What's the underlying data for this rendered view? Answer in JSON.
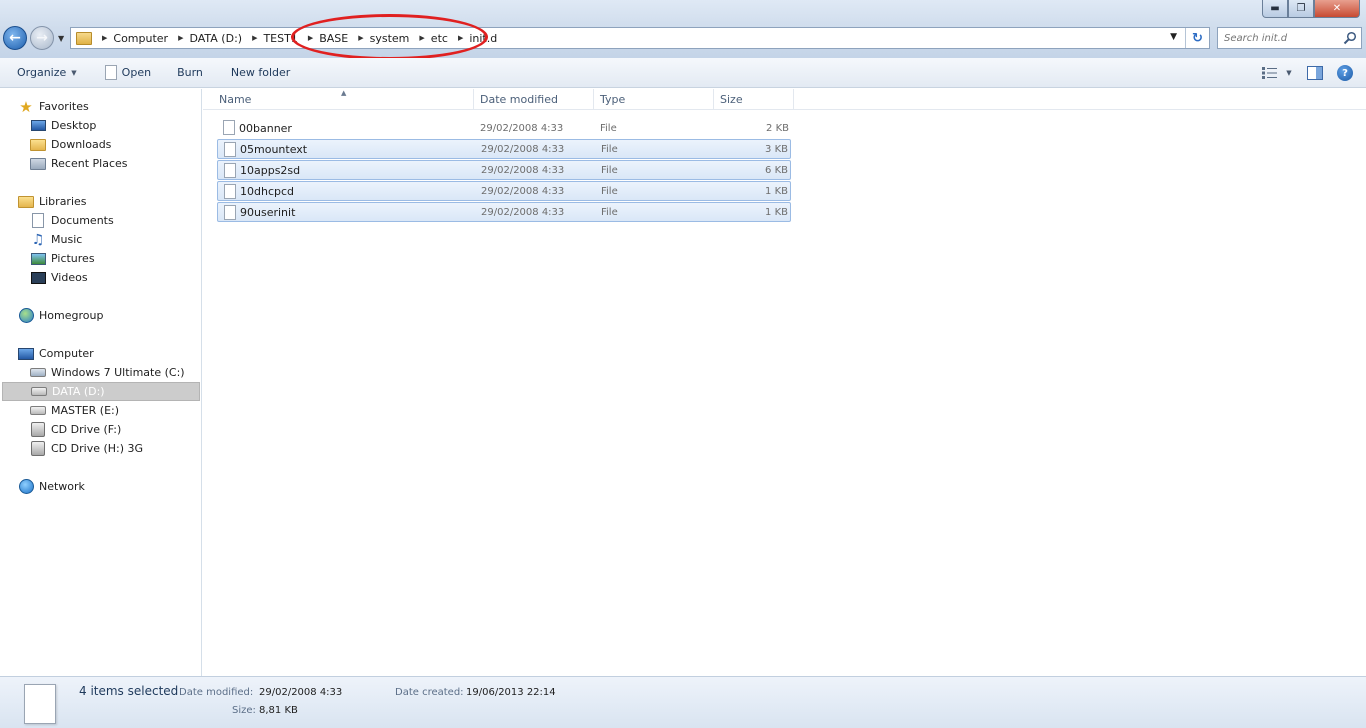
{
  "window_controls": {
    "minimize": "▬",
    "maximize": "❐",
    "close": "✕"
  },
  "breadcrumb": {
    "items": [
      "Computer",
      "DATA (D:)",
      "TEST1",
      "BASE",
      "system",
      "etc",
      "init.d"
    ]
  },
  "search": {
    "placeholder": "Search init.d"
  },
  "toolbar": {
    "organize": "Organize",
    "open": "Open",
    "burn": "Burn",
    "new_folder": "New folder"
  },
  "nav": {
    "favorites": "Favorites",
    "desktop": "Desktop",
    "downloads": "Downloads",
    "recent_places": "Recent Places",
    "libraries": "Libraries",
    "documents": "Documents",
    "music": "Music",
    "pictures": "Pictures",
    "videos": "Videos",
    "homegroup": "Homegroup",
    "computer": "Computer",
    "drive_c": "Windows 7 Ultimate (C:)",
    "drive_d": "DATA (D:)",
    "drive_e": "MASTER (E:)",
    "drive_f": "CD Drive (F:)",
    "drive_h": "CD Drive (H:) 3G",
    "network": "Network"
  },
  "columns": {
    "name": "Name",
    "date_modified": "Date modified",
    "type": "Type",
    "size": "Size"
  },
  "files": [
    {
      "name": "00banner",
      "date": "29/02/2008 4:33",
      "type": "File",
      "size": "2 KB",
      "selected": false
    },
    {
      "name": "05mountext",
      "date": "29/02/2008 4:33",
      "type": "File",
      "size": "3 KB",
      "selected": true
    },
    {
      "name": "10apps2sd",
      "date": "29/02/2008 4:33",
      "type": "File",
      "size": "6 KB",
      "selected": true
    },
    {
      "name": "10dhcpcd",
      "date": "29/02/2008 4:33",
      "type": "File",
      "size": "1 KB",
      "selected": true
    },
    {
      "name": "90userinit",
      "date": "29/02/2008 4:33",
      "type": "File",
      "size": "1 KB",
      "selected": true
    }
  ],
  "details": {
    "selection": "4 items selected",
    "date_modified_label": "Date modified:",
    "date_modified_value": "29/02/2008 4:33",
    "date_created_label": "Date created:",
    "date_created_value": "19/06/2013 22:14",
    "size_label": "Size:",
    "size_value": "8,81 KB"
  },
  "colors": {
    "accent": "#1e395b",
    "selection_bg": "#dae7f7",
    "selection_border": "#9bbbe4",
    "annotation": "#e02020"
  }
}
